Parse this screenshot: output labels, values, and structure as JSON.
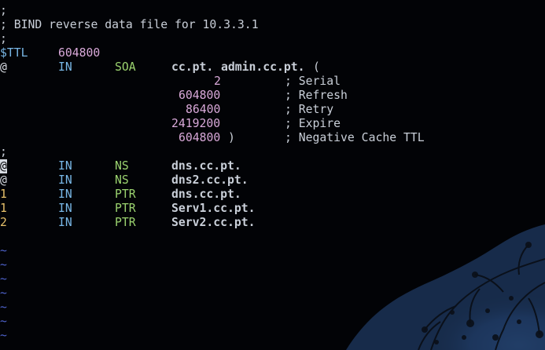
{
  "editor": {
    "comments": {
      "top_semicolon": ";",
      "title": "; BIND reverse data file for 10.3.3.1",
      "after_title": ";",
      "separator": ";"
    },
    "ttl": {
      "directive": "$TTL",
      "value": "604800"
    },
    "soa": {
      "owner": "@",
      "class": "IN",
      "type": "SOA",
      "primary": "cc.pt.",
      "admin": "admin.cc.pt.",
      "open_paren": "(",
      "close_paren": ")",
      "fields": [
        {
          "value": "2",
          "comment": "; Serial"
        },
        {
          "value": "604800",
          "comment": "; Refresh"
        },
        {
          "value": "86400",
          "comment": "; Retry"
        },
        {
          "value": "2419200",
          "comment": "; Expire"
        },
        {
          "value": "604800",
          "comment": "; Negative Cache TTL"
        }
      ]
    },
    "records": [
      {
        "owner": "@",
        "class": "IN",
        "type": "NS",
        "target": "dns.cc.pt."
      },
      {
        "owner": "@",
        "class": "IN",
        "type": "NS",
        "target": "dns2.cc.pt."
      },
      {
        "owner": "1",
        "class": "IN",
        "type": "PTR",
        "target": "dns.cc.pt."
      },
      {
        "owner": "1",
        "class": "IN",
        "type": "PTR",
        "target": "Serv1.cc.pt."
      },
      {
        "owner": "2",
        "class": "IN",
        "type": "PTR",
        "target": "Serv2.cc.pt."
      }
    ],
    "empty_line_marker": "~"
  },
  "colors": {
    "background": "#020306",
    "text": "#c9cfd8",
    "keyword_blue": "#79b7e6",
    "type_green": "#9bd36f",
    "number_magenta": "#d9a9d9",
    "owner_yellow": "#e6c06a",
    "tilde_blue": "#4d61c9"
  }
}
